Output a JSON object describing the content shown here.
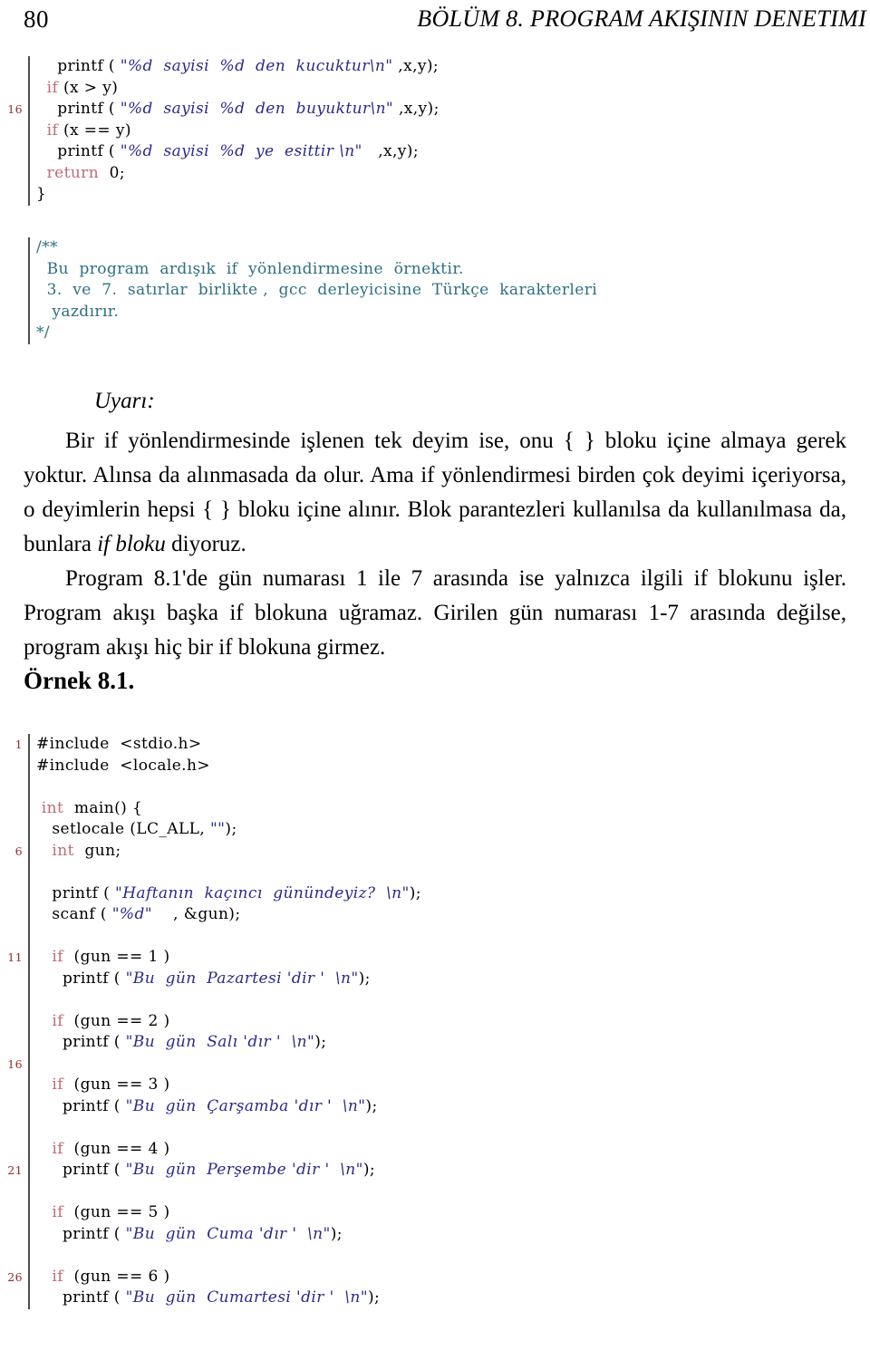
{
  "header": {
    "page_number": "80",
    "chapter_title": "BÖLÜM 8.  PROGRAM AKIŞININ DENETIMI"
  },
  "listing_top": {
    "lines": [
      {
        "no": "",
        "segments": [
          {
            "t": "plain",
            "v": "    printf ( "
          },
          {
            "t": "str",
            "v": "\"%d  sayisi  %d  den  kucuktur\\n\""
          },
          {
            "t": "plain",
            "v": " ,x,y);"
          }
        ]
      },
      {
        "no": "",
        "segments": [
          {
            "t": "kw",
            "v": "  if"
          },
          {
            "t": "plain",
            "v": " (x > y)"
          }
        ]
      },
      {
        "no": "16",
        "segments": [
          {
            "t": "plain",
            "v": "    printf ( "
          },
          {
            "t": "str",
            "v": "\"%d  sayisi  %d  den  buyuktur\\n\""
          },
          {
            "t": "plain",
            "v": " ,x,y);"
          }
        ]
      },
      {
        "no": "",
        "segments": [
          {
            "t": "kw",
            "v": "  if"
          },
          {
            "t": "plain",
            "v": " (x == y)"
          }
        ]
      },
      {
        "no": "",
        "segments": [
          {
            "t": "plain",
            "v": "    printf ( "
          },
          {
            "t": "str",
            "v": "\"%d  sayisi  %d  ye  esittir \\n\""
          },
          {
            "t": "plain",
            "v": "   ,x,y);"
          }
        ]
      },
      {
        "no": "",
        "segments": [
          {
            "t": "kw",
            "v": "  return"
          },
          {
            "t": "plain",
            "v": "  0;"
          }
        ]
      },
      {
        "no": "",
        "segments": [
          {
            "t": "plain",
            "v": "}"
          }
        ]
      }
    ]
  },
  "listing_comment": {
    "lines": [
      {
        "no": "",
        "segments": [
          {
            "t": "cmt",
            "v": "/**"
          }
        ]
      },
      {
        "no": "",
        "segments": [
          {
            "t": "cmt",
            "v": "  Bu  program  ardışık  if  yönlendirmesine  örnektir."
          }
        ]
      },
      {
        "no": "",
        "segments": [
          {
            "t": "cmt",
            "v": "  3.  ve  7.  satırlar  birlikte ,  gcc  derleyicisine  Türkçe  karakterleri"
          }
        ]
      },
      {
        "no": "",
        "segments": [
          {
            "t": "cmt",
            "v": "   yazdırır."
          }
        ]
      },
      {
        "no": "",
        "segments": [
          {
            "t": "cmt",
            "v": "*/"
          }
        ]
      }
    ]
  },
  "callout": {
    "label": "Uyarı:",
    "paragraph_pre": "Bir if yönlendirmesinde işlenen tek deyim ise, onu {  } bloku içine almaya gerek yoktur. Alınsa da alınmasada da olur. Ama if yönlendirmesi birden çok deyimi içeriyorsa, o deyimlerin hepsi {  } bloku içine alınır. Blok parantezleri kullanılsa da kullanılmasa da, bunlara ",
    "paragraph_italic": "if bloku",
    "paragraph_post": " diyoruz."
  },
  "paragraph2": "Program 8.1'de gün numarası 1 ile 7 arasında ise yalnızca ilgili if blokunu işler. Program akışı başka if blokuna uğramaz. Girilen gün numarası 1-7 arasında değilse, program akışı hiç bir if blokuna girmez.",
  "example_heading": "Örnek 8.1.",
  "listing_main": {
    "lines": [
      {
        "no": "1",
        "segments": [
          {
            "t": "plain",
            "v": "#include  <stdio.h>"
          }
        ]
      },
      {
        "no": "",
        "segments": [
          {
            "t": "plain",
            "v": "#include  <locale.h>"
          }
        ]
      },
      {
        "no": "",
        "segments": [
          {
            "t": "plain",
            "v": ""
          }
        ]
      },
      {
        "no": "",
        "segments": [
          {
            "t": "kw",
            "v": " int"
          },
          {
            "t": "plain",
            "v": "  main() {"
          }
        ]
      },
      {
        "no": "",
        "segments": [
          {
            "t": "plain",
            "v": "   setlocale (LC_ALL, "
          },
          {
            "t": "str",
            "v": "\"\""
          },
          {
            "t": "plain",
            "v": ");"
          }
        ]
      },
      {
        "no": "6",
        "segments": [
          {
            "t": "kw",
            "v": "   int"
          },
          {
            "t": "plain",
            "v": "  gun;"
          }
        ]
      },
      {
        "no": "",
        "segments": [
          {
            "t": "plain",
            "v": ""
          }
        ]
      },
      {
        "no": "",
        "segments": [
          {
            "t": "plain",
            "v": "   printf ( "
          },
          {
            "t": "str",
            "v": "\"Haftanın  kaçıncı  günündeyiz?  \\n\""
          },
          {
            "t": "plain",
            "v": ");"
          }
        ]
      },
      {
        "no": "",
        "segments": [
          {
            "t": "plain",
            "v": "   scanf ( "
          },
          {
            "t": "str",
            "v": "\"%d\""
          },
          {
            "t": "plain",
            "v": "    , &gun);"
          }
        ]
      },
      {
        "no": "",
        "segments": [
          {
            "t": "plain",
            "v": ""
          }
        ]
      },
      {
        "no": "11",
        "segments": [
          {
            "t": "kw",
            "v": "   if"
          },
          {
            "t": "plain",
            "v": "  (gun == 1 )"
          }
        ]
      },
      {
        "no": "",
        "segments": [
          {
            "t": "plain",
            "v": "     printf ( "
          },
          {
            "t": "str",
            "v": "\"Bu  gün  Pazartesi 'dir '  \\n\""
          },
          {
            "t": "plain",
            "v": ");"
          }
        ]
      },
      {
        "no": "",
        "segments": [
          {
            "t": "plain",
            "v": ""
          }
        ]
      },
      {
        "no": "",
        "segments": [
          {
            "t": "kw",
            "v": "   if"
          },
          {
            "t": "plain",
            "v": "  (gun == 2 )"
          }
        ]
      },
      {
        "no": "",
        "segments": [
          {
            "t": "plain",
            "v": "     printf ( "
          },
          {
            "t": "str",
            "v": "\"Bu  gün  Salı 'dır '  \\n\""
          },
          {
            "t": "plain",
            "v": ");"
          }
        ]
      },
      {
        "no": "16",
        "segments": [
          {
            "t": "plain",
            "v": ""
          }
        ]
      },
      {
        "no": "",
        "segments": [
          {
            "t": "kw",
            "v": "   if"
          },
          {
            "t": "plain",
            "v": "  (gun == 3 )"
          }
        ]
      },
      {
        "no": "",
        "segments": [
          {
            "t": "plain",
            "v": "     printf ( "
          },
          {
            "t": "str",
            "v": "\"Bu  gün  Çarşamba 'dır '  \\n\""
          },
          {
            "t": "plain",
            "v": ");"
          }
        ]
      },
      {
        "no": "",
        "segments": [
          {
            "t": "plain",
            "v": ""
          }
        ]
      },
      {
        "no": "",
        "segments": [
          {
            "t": "kw",
            "v": "   if"
          },
          {
            "t": "plain",
            "v": "  (gun == 4 )"
          }
        ]
      },
      {
        "no": "21",
        "segments": [
          {
            "t": "plain",
            "v": "     printf ( "
          },
          {
            "t": "str",
            "v": "\"Bu  gün  Perşembe 'dir '  \\n\""
          },
          {
            "t": "plain",
            "v": ");"
          }
        ]
      },
      {
        "no": "",
        "segments": [
          {
            "t": "plain",
            "v": ""
          }
        ]
      },
      {
        "no": "",
        "segments": [
          {
            "t": "kw",
            "v": "   if"
          },
          {
            "t": "plain",
            "v": "  (gun == 5 )"
          }
        ]
      },
      {
        "no": "",
        "segments": [
          {
            "t": "plain",
            "v": "     printf ( "
          },
          {
            "t": "str",
            "v": "\"Bu  gün  Cuma 'dır '  \\n\""
          },
          {
            "t": "plain",
            "v": ");"
          }
        ]
      },
      {
        "no": "",
        "segments": [
          {
            "t": "plain",
            "v": ""
          }
        ]
      },
      {
        "no": "26",
        "segments": [
          {
            "t": "kw",
            "v": "   if"
          },
          {
            "t": "plain",
            "v": "  (gun == 6 )"
          }
        ]
      },
      {
        "no": "",
        "segments": [
          {
            "t": "plain",
            "v": "     printf ( "
          },
          {
            "t": "str",
            "v": "\"Bu  gün  Cumartesi 'dir '  \\n\""
          },
          {
            "t": "plain",
            "v": ");"
          }
        ]
      }
    ]
  },
  "colors": {
    "keyword": "#c06b74",
    "string": "#2a2a8c",
    "comment": "#2e6e84",
    "lineno": "#9c2b2b",
    "rule": "#4d4d4d"
  }
}
